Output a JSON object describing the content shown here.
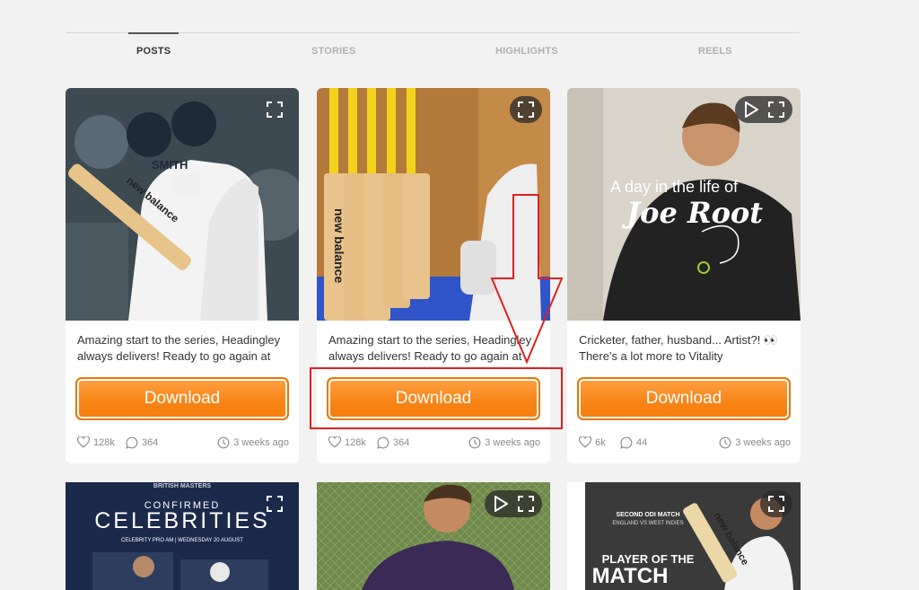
{
  "tabs": [
    "POSTS",
    "STORIES",
    "HIGHLIGHTS",
    "REELS"
  ],
  "active_tab": "POSTS",
  "download_label": "Download",
  "posts": [
    {
      "caption": "Amazing start to the series, Headingley always delivers! Ready to go again at",
      "likes": "128k",
      "comments": "364",
      "time": "3 weeks ago",
      "media_type": "image",
      "image_text": {
        "jersey_name": "SMITH",
        "bat_brand": "new balance"
      }
    },
    {
      "caption": "Amazing start to the series, Headingley always delivers! Ready to go again at",
      "likes": "128k",
      "comments": "364",
      "time": "3 weeks ago",
      "media_type": "image",
      "image_text": {
        "bat_brand": "new balance"
      }
    },
    {
      "caption": "Cricketer, father, husband... Artist?! 👀 There's a lot more to Vitality",
      "likes": "6k",
      "comments": "44",
      "time": "3 weeks ago",
      "media_type": "video",
      "image_text": {
        "line1": "A day in the life of",
        "line2": "Joe Root"
      }
    }
  ],
  "row2": [
    {
      "media_type": "image",
      "image_text": {
        "top": "BRITISH MASTERS",
        "title": "CELEBRITIES",
        "pre": "CONFIRMED",
        "sub": "CELEBRITY PRO AM  |  WEDNESDAY 20 AUGUST"
      }
    },
    {
      "media_type": "video"
    },
    {
      "media_type": "image",
      "image_text": {
        "top": "SECOND ODI MATCH",
        "sub": "ENGLAND VS WEST INDIES",
        "title1": "PLAYER OF THE",
        "title2": "MATCH",
        "bat": "new balance"
      }
    }
  ],
  "colors": {
    "accent": "#f88416",
    "highlight_annotation": "#e02020"
  }
}
